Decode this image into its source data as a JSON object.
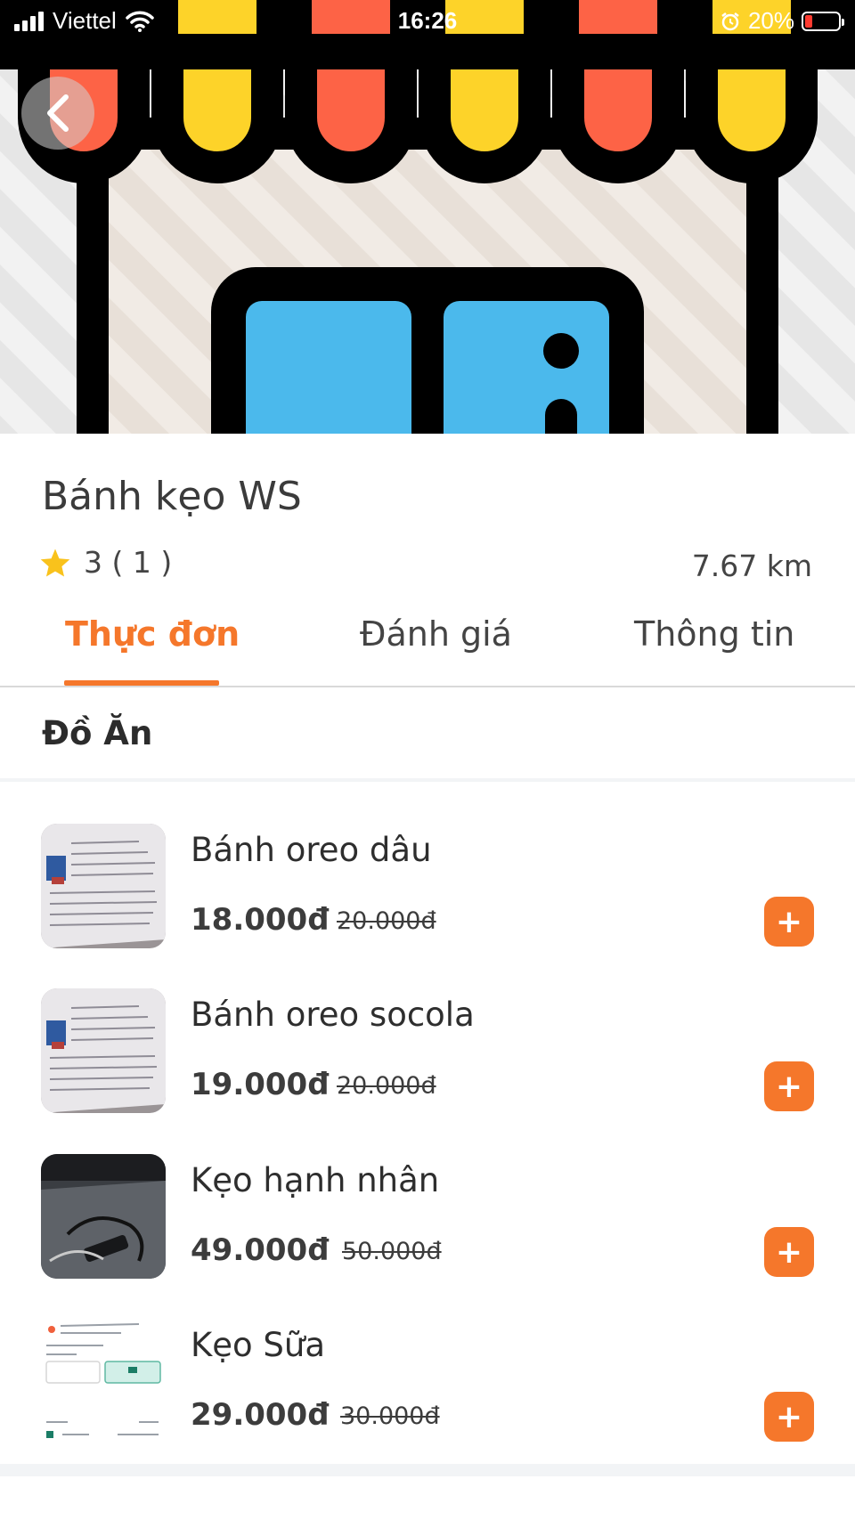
{
  "status_bar": {
    "carrier": "Viettel",
    "time": "16:26",
    "battery": "20%",
    "icons": [
      "signal-icon",
      "wifi-icon",
      "alarm-icon",
      "battery-icon"
    ]
  },
  "store": {
    "name": "Bánh kẹo WS",
    "rating": "3 ( 1 )",
    "distance": "7.67 km"
  },
  "tabs": [
    {
      "label": "Thực đơn",
      "active": true
    },
    {
      "label": "Đánh giá",
      "active": false
    },
    {
      "label": "Thông tin",
      "active": false
    }
  ],
  "section": {
    "title": "Đồ Ăn"
  },
  "menu_items": [
    {
      "name": "Bánh oreo dâu",
      "price": "18.000đ",
      "old_price": "20.000đ",
      "add_label": "+"
    },
    {
      "name": "Bánh oreo socola",
      "price": "19.000đ",
      "old_price": "20.000đ",
      "add_label": "+"
    },
    {
      "name": "Kẹo hạnh nhân",
      "price": "49.000đ",
      "old_price": "50.000đ",
      "add_label": "+"
    },
    {
      "name": "Kẹo Sữa",
      "price": "29.000đ",
      "old_price": "30.000đ",
      "add_label": "+"
    }
  ],
  "colors": {
    "accent": "#f5772b",
    "star": "#f9c21c",
    "awning_red": "#fd6346",
    "awning_yellow": "#fdd329",
    "window_blue": "#4bb9ec"
  }
}
